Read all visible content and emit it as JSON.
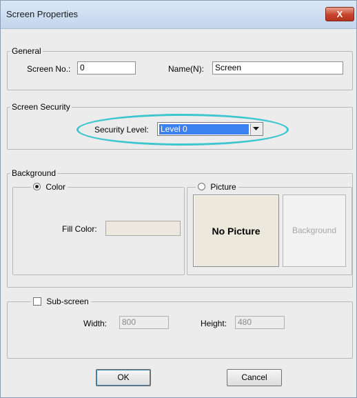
{
  "window": {
    "title": "Screen Properties",
    "close_glyph": "X"
  },
  "general": {
    "legend": "General",
    "screen_no_label": "Screen No.:",
    "screen_no_value": "0",
    "name_label": "Name(N):",
    "name_value": "Screen"
  },
  "security": {
    "legend": "Screen Security",
    "level_label": "Security Level:",
    "level_value": "Level 0"
  },
  "background": {
    "legend": "Background",
    "color_option": "Color",
    "color_selected": true,
    "picture_option": "Picture",
    "picture_selected": false,
    "fill_color_label": "Fill Color:",
    "fill_color": "#ece8dd",
    "preview_text": "No Picture",
    "background_button": "Background"
  },
  "subscreen": {
    "checkbox_label": "Sub-screen",
    "checked": false,
    "width_label": "Width:",
    "width_value": "800",
    "height_label": "Height:",
    "height_value": "480"
  },
  "buttons": {
    "ok": "OK",
    "cancel": "Cancel"
  },
  "colors": {
    "highlight": "#3cc6cf",
    "selection": "#3b82f0"
  }
}
